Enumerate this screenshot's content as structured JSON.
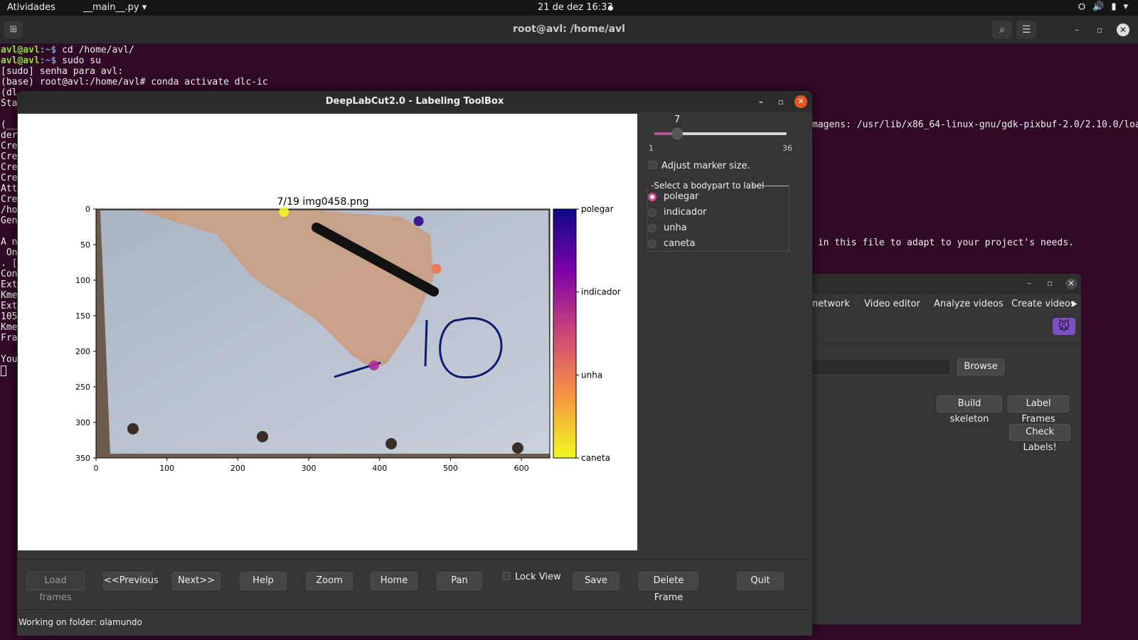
{
  "topbar": {
    "activities": "Atividades",
    "app_menu": "__main__.py ▾",
    "clock": "21 de dez  16:33",
    "tray": [
      "⛭",
      "🔊",
      "▮",
      "▾"
    ]
  },
  "terminal": {
    "title": "root@avl: /home/avl",
    "prompt_user": "avl@avl",
    "prompt_path": ":~$",
    "lines": [
      " cd /home/avl/",
      " sudo su"
    ],
    "plain_lines": [
      "[sudo] senha para avl:",
      "(base) root@avl:/home/avl# conda activate dlc-ic",
      "(dl",
      "Sta",
      "",
      "(__",
      "der",
      "Cre",
      "Cre",
      "Cre",
      "Cre",
      "Att",
      "Cre",
      "/ho",
      "Gen",
      "",
      "A n",
      " On",
      ". [",
      "Con",
      "Ext",
      "Kme",
      "Ext",
      "105",
      "Kme",
      "Fra",
      "",
      "You"
    ],
    "right_line_1": "magens: /usr/lib/x86_64-linux-gnu/gdk-pixbuf-2.0/2.10.0/loa",
    "right_line_2": " in this file to adapt to your project's needs."
  },
  "main_window": {
    "tabs": [
      "network",
      "Video editor",
      "Analyze videos",
      "Create videos"
    ],
    "browse": "Browse",
    "build_skeleton": "Build skeleton",
    "label_frames": "Label Frames",
    "check_labels": "Check Labels!"
  },
  "labeling": {
    "window_title": "DeepLabCut2.0 - Labeling ToolBox",
    "plot_title": "7/19 img0458.png",
    "slider": {
      "value": "7",
      "min": "1",
      "max": "36",
      "fraction": 0.171
    },
    "adjust_marker": "Adjust marker size.",
    "bodypart_group": "Select a bodypart to label",
    "bodyparts": [
      "polegar",
      "indicador",
      "unha",
      "caneta"
    ],
    "selected_bodypart": "polegar",
    "x_ticks": [
      "0",
      "100",
      "200",
      "300",
      "400",
      "500",
      "600"
    ],
    "y_ticks": [
      "0",
      "50",
      "100",
      "150",
      "200",
      "250",
      "300",
      "350"
    ],
    "colorbar_labels": [
      "polegar",
      "indicador",
      "unha",
      "caneta"
    ],
    "colorbar_colors": [
      "#0d0887",
      "#7e03a8",
      "#cc4778",
      "#f89540",
      "#f0f921"
    ],
    "markers": [
      {
        "name": "caneta",
        "x": 265,
        "y": 4,
        "color": "#f0f921"
      },
      {
        "name": "polegar",
        "x": 455,
        "y": 17,
        "color": "#2c0a8a"
      },
      {
        "name": "unha",
        "x": 480,
        "y": 84,
        "color": "#f3724a"
      },
      {
        "name": "indicador",
        "x": 392,
        "y": 220,
        "color": "#b02d9a"
      }
    ],
    "buttons": [
      "Load frames",
      "<<Previous",
      "Next>>",
      "Help",
      "Zoom",
      "Home",
      "Pan",
      "Save",
      "Delete Frame",
      "Quit"
    ],
    "lock_view": "Lock View",
    "status": "Working on folder: olamundo"
  }
}
